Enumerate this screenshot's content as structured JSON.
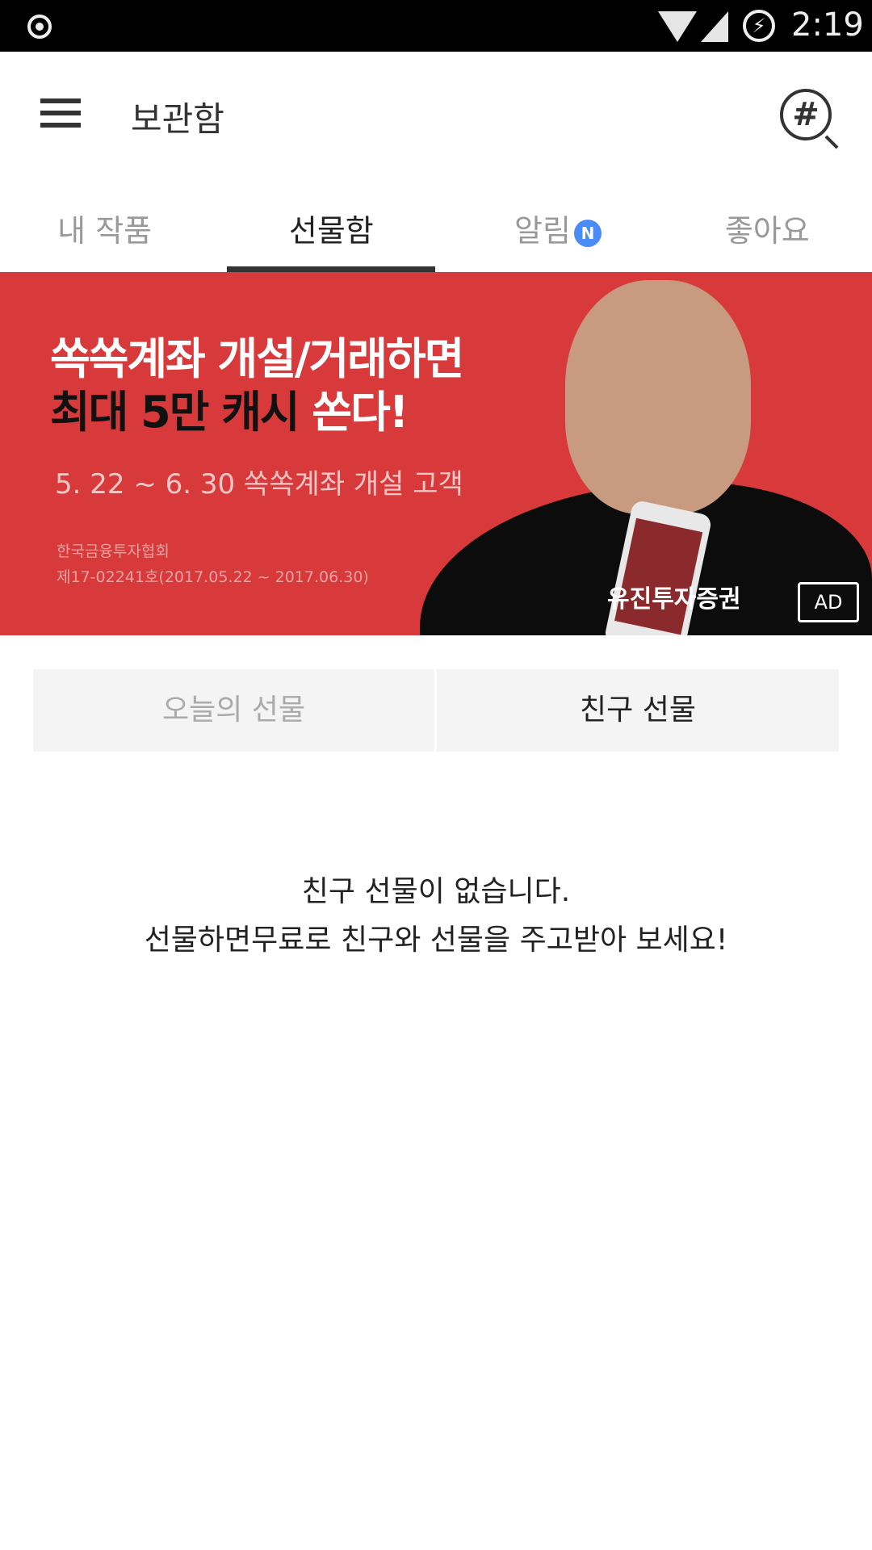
{
  "status_bar": {
    "time": "2:19"
  },
  "app_bar": {
    "title": "보관함",
    "menu_icon": "hamburger-icon",
    "search_icon": "hashtag-search-icon"
  },
  "tabs": [
    {
      "label": "내 작품"
    },
    {
      "label": "선물함",
      "active": true
    },
    {
      "label": "알림",
      "badge": "N"
    },
    {
      "label": "좋아요"
    }
  ],
  "banner": {
    "headline_1": "쏙쏙계좌 개설/거래하면",
    "headline_2a": "최대 5만 캐시",
    "headline_2b": "쏜다!",
    "period": "5. 22 ~ 6. 30 쏙쏙계좌 개설 고객",
    "notice_1": "한국금융투자협회",
    "notice_2": "제17-02241호(2017.05.22 ~ 2017.06.30)",
    "brand": "유진투자증권",
    "ad_label": "AD",
    "color": "#d83a3c"
  },
  "segments": [
    {
      "label": "오늘의 선물"
    },
    {
      "label": "친구 선물",
      "active": true
    }
  ],
  "empty": {
    "line1": "친구 선물이 없습니다.",
    "line2": "선물하면무료로 친구와 선물을 주고받아 보세요!"
  }
}
